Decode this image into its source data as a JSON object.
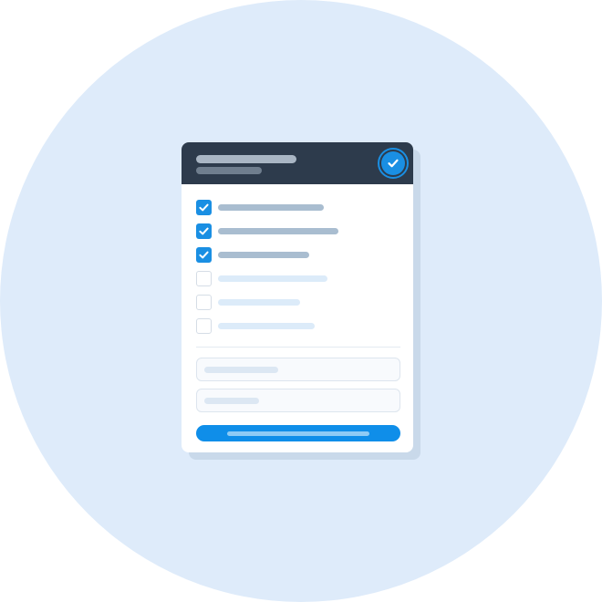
{
  "colors": {
    "background_circle": "#deebfa",
    "card": "#ffffff",
    "header": "#2d3b4c",
    "accent": "#1a8fe3",
    "button": "#0f8ee9",
    "checkmark": "#ffffff"
  },
  "header": {
    "status_icon": "check-circle-icon",
    "status": "complete"
  },
  "checklist": {
    "items": [
      {
        "checked": true,
        "length": 0.58
      },
      {
        "checked": true,
        "length": 0.66
      },
      {
        "checked": true,
        "length": 0.5
      },
      {
        "checked": false,
        "length": 0.6
      },
      {
        "checked": false,
        "length": 0.45
      },
      {
        "checked": false,
        "length": 0.53
      }
    ],
    "completed_fraction": 0.5
  },
  "form": {
    "fields": [
      {
        "placeholder_length": 0.36
      },
      {
        "placeholder_length": 0.27
      }
    ]
  },
  "button": {
    "icon": "none"
  }
}
